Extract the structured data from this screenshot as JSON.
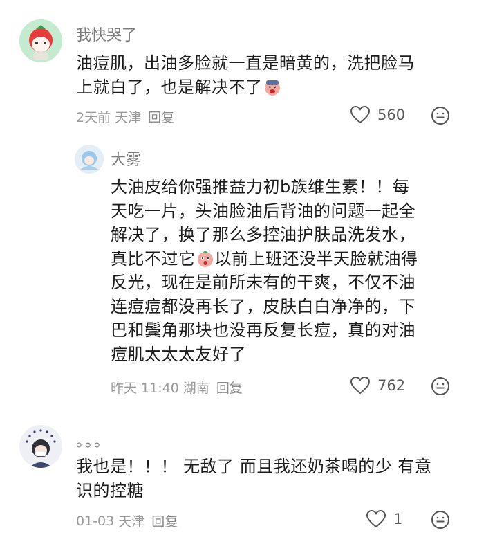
{
  "comments": [
    {
      "username": "我快哭了",
      "text_lines": [
        "油痘肌，出油多脸就一直是暗黄的，洗把脸马",
        "上就白了，也是解决不了"
      ],
      "emoji": "crying-face-emoji",
      "date": "2天前",
      "location": "天津",
      "reply_label": "回复",
      "likes": "560"
    },
    {
      "username": "大雾",
      "text_lines": [
        "大油皮给你强推益力初b族维生素！！每",
        "天吃一片，头油脸油后背油的问题一起全",
        "解决了，换了那么多控油护肤品洗发水，",
        "真比不过它",
        "以前上班还没半天脸就油得",
        "反光，现在是前所未有的干爽，不仅不油",
        "连痘痘都没再长了，皮肤白白净净的，下",
        "巴和鬓角那块也没再反复长痘，真的对油",
        "痘肌太太太友好了"
      ],
      "emoji": "surprised-face-emoji",
      "date": "昨天 11:40",
      "location": "湖南",
      "reply_label": "回复",
      "likes": "762"
    },
    {
      "username": "。。。",
      "text_lines": [
        "我也是！！！ 无敌了 而且我还奶茶喝的少 有意",
        "识的控糖"
      ],
      "date": "01-03",
      "location": "天津",
      "reply_label": "回复",
      "likes": "1"
    }
  ],
  "icons": {
    "like": "heart-outline-icon",
    "react": "smiley-icon"
  },
  "colors": {
    "username": "#7d7d7d",
    "meta": "#9a9a9a",
    "text": "#1c1c1c"
  }
}
